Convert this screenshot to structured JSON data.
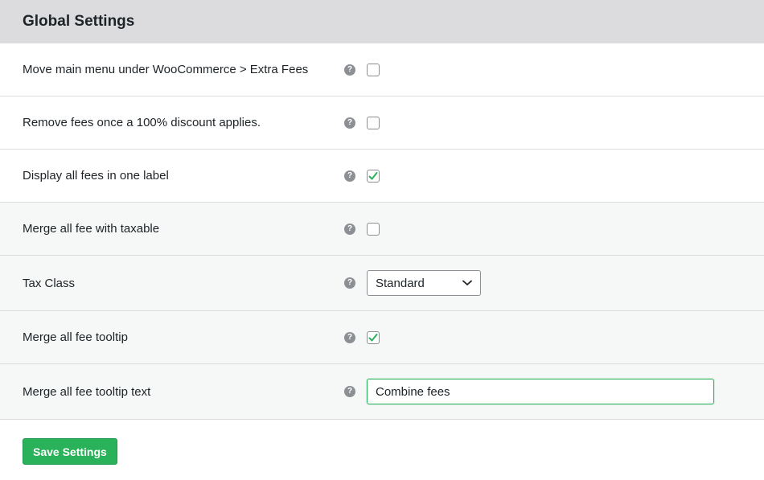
{
  "header": {
    "title": "Global Settings"
  },
  "colors": {
    "accent": "#2ab25a",
    "header_bg": "#dcdcde",
    "checkmark": "#2ab25a"
  },
  "settings": [
    {
      "label": "Move main menu under WooCommerce > Extra Fees",
      "control": "checkbox",
      "checked": false
    },
    {
      "label": "Remove fees once a 100% discount applies.",
      "control": "checkbox",
      "checked": false
    },
    {
      "label": "Display all fees in one label",
      "control": "checkbox",
      "checked": true
    },
    {
      "label": "Merge all fee with taxable",
      "control": "checkbox",
      "checked": false
    },
    {
      "label": "Tax Class",
      "control": "select",
      "value": "Standard"
    },
    {
      "label": "Merge all fee tooltip",
      "control": "checkbox",
      "checked": true
    },
    {
      "label": "Merge all fee tooltip text",
      "control": "text",
      "value": "Combine fees"
    }
  ],
  "help_icon": {
    "name": "help-icon",
    "glyph": "?"
  },
  "footer": {
    "save_label": "Save Settings"
  }
}
